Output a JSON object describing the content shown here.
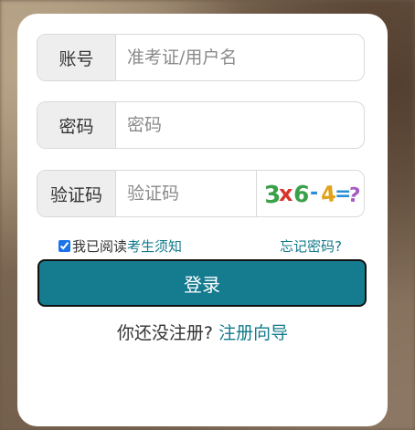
{
  "form": {
    "account": {
      "label": "账号",
      "placeholder": "准考证/用户名",
      "value": ""
    },
    "password": {
      "label": "密码",
      "placeholder": "密码",
      "value": ""
    },
    "captcha": {
      "label": "验证码",
      "placeholder": "验证码",
      "value": "",
      "image_text": "3 x 6 - 4 = ?"
    }
  },
  "agreement": {
    "checked": true,
    "prefix": "我已阅读",
    "link": "考生须知"
  },
  "forgot_password": "忘记密码?",
  "login_button": "登录",
  "register": {
    "prompt": "你还没注册?",
    "link": "注册向导"
  },
  "colors": {
    "accent": "#157b8f",
    "link": "#137a8c"
  }
}
